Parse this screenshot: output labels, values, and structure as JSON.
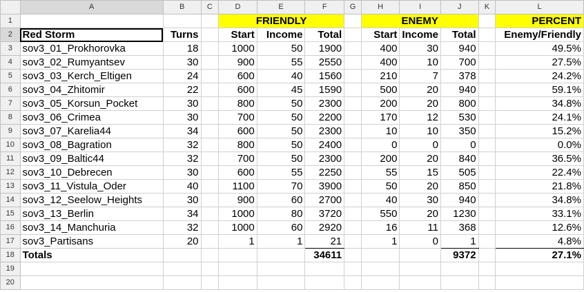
{
  "columns": [
    "A",
    "B",
    "C",
    "D",
    "E",
    "F",
    "G",
    "H",
    "I",
    "J",
    "K",
    "L"
  ],
  "group_headers": {
    "friendly": "FRIENDLY",
    "enemy": "ENEMY",
    "percent": "PERCENT"
  },
  "headers": {
    "name": "Red Storm",
    "turns": "Turns",
    "f_start": "Start",
    "f_income": "Income",
    "f_total": "Total",
    "e_start": "Start",
    "e_income": "Income",
    "e_total": "Total",
    "ratio": "Enemy/Friendly"
  },
  "rows": [
    [
      "sov3_01_Prokhorovka",
      "18",
      "1000",
      "50",
      "1900",
      "400",
      "30",
      "940",
      "49.5%"
    ],
    [
      "sov3_02_Rumyantsev",
      "30",
      "900",
      "55",
      "2550",
      "400",
      "10",
      "700",
      "27.5%"
    ],
    [
      "sov3_03_Kerch_Eltigen",
      "24",
      "600",
      "40",
      "1560",
      "210",
      "7",
      "378",
      "24.2%"
    ],
    [
      "sov3_04_Zhitomir",
      "22",
      "600",
      "45",
      "1590",
      "500",
      "20",
      "940",
      "59.1%"
    ],
    [
      "sov3_05_Korsun_Pocket",
      "30",
      "800",
      "50",
      "2300",
      "200",
      "20",
      "800",
      "34.8%"
    ],
    [
      "sov3_06_Crimea",
      "30",
      "700",
      "50",
      "2200",
      "170",
      "12",
      "530",
      "24.1%"
    ],
    [
      "sov3_07_Karelia44",
      "34",
      "600",
      "50",
      "2300",
      "10",
      "10",
      "350",
      "15.2%"
    ],
    [
      "sov3_08_Bagration",
      "32",
      "800",
      "50",
      "2400",
      "0",
      "0",
      "0",
      "0.0%"
    ],
    [
      "sov3_09_Baltic44",
      "32",
      "700",
      "50",
      "2300",
      "200",
      "20",
      "840",
      "36.5%"
    ],
    [
      "sov3_10_Debrecen",
      "30",
      "600",
      "55",
      "2250",
      "55",
      "15",
      "505",
      "22.4%"
    ],
    [
      "sov3_11_Vistula_Oder",
      "40",
      "1100",
      "70",
      "3900",
      "50",
      "20",
      "850",
      "21.8%"
    ],
    [
      "sov3_12_Seelow_Heights",
      "30",
      "900",
      "60",
      "2700",
      "40",
      "30",
      "940",
      "34.8%"
    ],
    [
      "sov3_13_Berlin",
      "34",
      "1000",
      "80",
      "3720",
      "550",
      "20",
      "1230",
      "33.1%"
    ],
    [
      "sov3_14_Manchuria",
      "32",
      "1000",
      "60",
      "2920",
      "16",
      "11",
      "368",
      "12.6%"
    ],
    [
      "sov3_Partisans",
      "20",
      "1",
      "1",
      "21",
      "1",
      "0",
      "1",
      "4.8%"
    ]
  ],
  "totals": {
    "label": "Totals",
    "friendly_total": "34611",
    "enemy_total": "9372",
    "percent": "27.1%"
  }
}
